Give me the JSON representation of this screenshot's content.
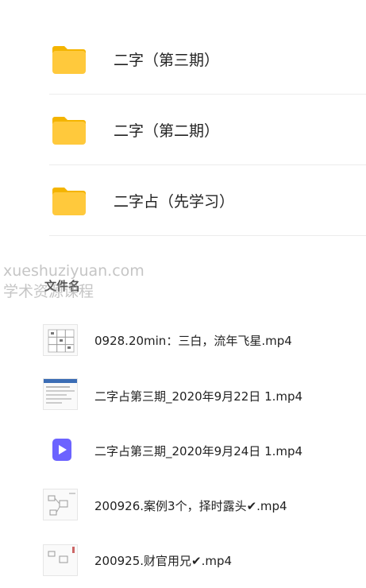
{
  "folders": [
    {
      "name": "二字（第三期）",
      "icon": "folder-icon"
    },
    {
      "name": "二字（第二期）",
      "icon": "folder-icon"
    },
    {
      "name": "二字占（先学习）",
      "icon": "folder-icon"
    }
  ],
  "files_section_title": "文件名",
  "watermark": {
    "line1": "xueshuziyuan.com",
    "line2": "学术资源课程"
  },
  "files": [
    {
      "name": "0928.20min：三白，流年飞星.mp4",
      "icon": "grid-thumbnail"
    },
    {
      "name": "二字占第三期_2020年9月22日 1.mp4",
      "icon": "screen-thumbnail"
    },
    {
      "name": "二字占第三期_2020年9月24日 1.mp4",
      "icon": "video-file-icon"
    },
    {
      "name": "200926.案例3个，择时露头✔.mp4",
      "icon": "diagram-thumbnail"
    },
    {
      "name": "200925.财官用兄✔.mp4",
      "icon": "diagram-thumbnail"
    }
  ],
  "colors": {
    "folder": "#FFC93C",
    "folder_tab": "#F4B400",
    "video_icon": "#6C63FF"
  }
}
